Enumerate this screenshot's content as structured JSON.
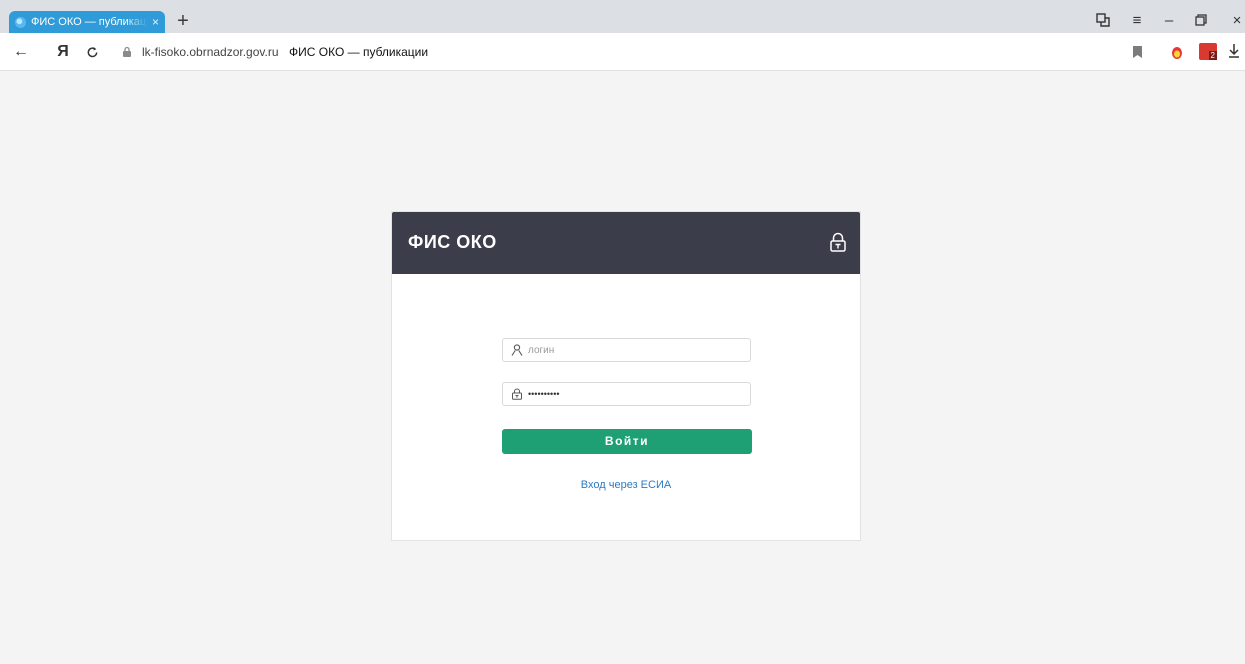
{
  "browser": {
    "tab": {
      "title": "ФИС ОКО — публикации",
      "close": "×"
    },
    "new_tab": "+",
    "window_controls": {
      "tabs_icon": "⧉",
      "menu": "≡",
      "minimize": "–",
      "restore": "❐",
      "close": "×"
    },
    "nav": {
      "back": "←",
      "yandex": "Я",
      "reload": "↻"
    },
    "address": {
      "domain": "lk-fisoko.obrnadzor.gov.ru",
      "page_title": "ФИС ОКО — публикации"
    },
    "extensions": {
      "badge_count": "2"
    }
  },
  "login": {
    "brand": "ФИС ОКО",
    "username_placeholder": "логин",
    "password_value": "••••••••••",
    "submit_label": "Войти",
    "esia_link": "Вход через ЕСИА"
  },
  "colors": {
    "header_bg": "#3b3d4a",
    "button_bg": "#1fa074",
    "link": "#2a7ac4",
    "tab_bg": "#2f9bd9"
  }
}
